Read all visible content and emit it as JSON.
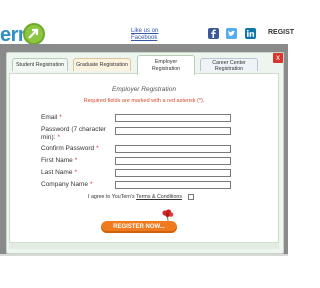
{
  "header": {
    "logo_text": "erm",
    "fb_like_line1": "Like us on",
    "fb_like_line2": "Facebook",
    "register_cut": "REGIST",
    "social_icons": [
      "facebook-icon",
      "twitter-icon",
      "linkedin-icon"
    ]
  },
  "modal": {
    "close_label": "x",
    "tabs": [
      {
        "label": "Student Registration"
      },
      {
        "label": "Graduate Registration"
      },
      {
        "label_line1": "Employer",
        "label_line2": "Registration"
      },
      {
        "label_line1": "Career Center",
        "label_line2": "Registration"
      }
    ],
    "active_tab": "Employer Registration",
    "form_title": "Employer Registration",
    "required_note": "Required fields are marked with a red asterisk (*).",
    "fields": [
      {
        "label": "Email",
        "value": ""
      },
      {
        "label_line1": "Password (7 character",
        "label_line2": "min):",
        "value": ""
      },
      {
        "label": "Confirm Password",
        "value": ""
      },
      {
        "label": "First Name",
        "value": ""
      },
      {
        "label": "Last Name",
        "value": ""
      },
      {
        "label": "Company Name",
        "value": ""
      }
    ],
    "required_star": "*",
    "agree_prefix": "I agree to YouTern's",
    "agree_terms": "Terms & Conditions",
    "register_button": "REGISTER NOW..."
  },
  "colors": {
    "accent_orange": "#f07b1e",
    "required_red": "#d94a2b",
    "overlay_grey": "#8a8a8a"
  }
}
